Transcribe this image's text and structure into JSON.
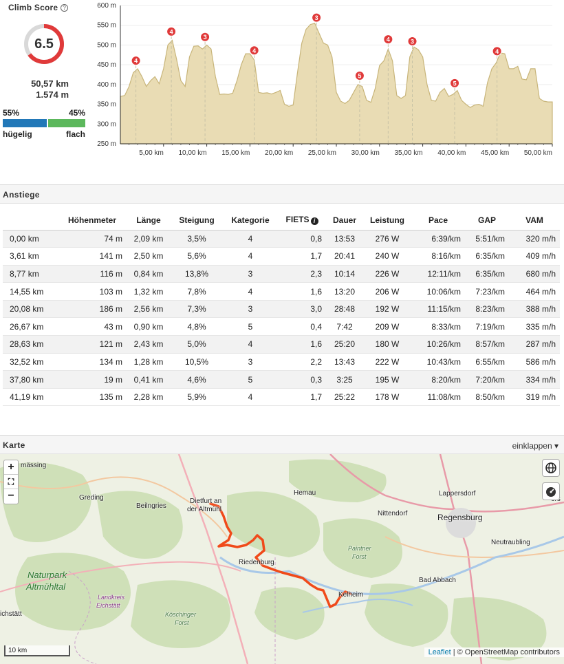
{
  "climb_score": {
    "title": "Climb Score",
    "help_icon": "?",
    "score": "6.5",
    "score_fraction": 0.65,
    "distance": "50,57 km",
    "elevation": "1.574 m",
    "hilly_pct": "55%",
    "flat_pct": "45%",
    "hilly_fraction": 0.55,
    "hilly_label": "hügelig",
    "flat_label": "flach",
    "colors": {
      "ring": "#e03a3a",
      "ring_bg": "#d9d9d9",
      "hilly": "#2278b8",
      "flat": "#5cb85c"
    }
  },
  "chart_data": {
    "type": "area",
    "title": "",
    "xlabel": "",
    "ylabel": "",
    "xlim": [
      0,
      50
    ],
    "ylim": [
      250,
      600
    ],
    "x_ticks": [
      "5,00 km",
      "10,00 km",
      "15,00 km",
      "20,00 km",
      "25,00 km",
      "30,00 km",
      "35,00 km",
      "40,00 km",
      "45,00 km",
      "50,00 km"
    ],
    "y_ticks": [
      "600 m",
      "550 m",
      "500 m",
      "450 m",
      "400 m",
      "350 m",
      "300 m",
      "250 m"
    ],
    "series": [
      {
        "values_km": [
          0,
          0.5,
          1,
          1.5,
          2,
          2.5,
          3,
          3.5,
          4,
          4.5,
          5,
          5.5,
          6,
          6.5,
          7,
          7.5,
          8,
          8.5,
          9,
          9.5,
          10,
          10.5,
          11,
          11.5,
          12,
          12.5,
          13,
          13.5,
          14,
          14.5,
          15,
          15.5,
          16,
          16.5,
          17,
          17.5,
          18,
          18.5,
          19,
          19.5,
          20,
          20.5,
          21,
          21.5,
          22,
          22.5,
          23,
          23.5,
          24,
          24.5,
          25,
          25.5,
          26,
          26.5,
          27,
          27.5,
          28,
          28.5,
          29,
          29.5,
          30,
          30.5,
          31,
          31.5,
          32,
          32.5,
          33,
          33.5,
          34,
          34.5,
          35,
          35.5,
          36,
          36.5,
          37,
          37.5,
          38,
          38.5,
          39,
          39.5,
          40,
          40.5,
          41,
          41.5,
          42,
          42.5,
          43,
          43.5,
          44,
          44.5,
          45,
          45.5,
          46,
          46.5,
          47,
          47.5,
          48,
          48.5,
          49,
          49.5,
          50
        ],
        "values_m": [
          370,
          372,
          395,
          430,
          440,
          420,
          395,
          410,
          420,
          402,
          440,
          500,
          512,
          465,
          410,
          395,
          470,
          497,
          498,
          490,
          500,
          490,
          420,
          375,
          376,
          375,
          378,
          410,
          450,
          478,
          478,
          462,
          380,
          378,
          379,
          376,
          380,
          385,
          350,
          345,
          348,
          430,
          505,
          540,
          552,
          555,
          530,
          505,
          500,
          470,
          380,
          358,
          352,
          360,
          380,
          400,
          395,
          360,
          355,
          390,
          448,
          460,
          490,
          460,
          372,
          365,
          372,
          470,
          495,
          488,
          470,
          400,
          360,
          358,
          380,
          390,
          370,
          375,
          385,
          360,
          350,
          342,
          348,
          350,
          345,
          405,
          440,
          455,
          480,
          478,
          440,
          440,
          446,
          414,
          412,
          440,
          440,
          365,
          358,
          356,
          356,
          360,
          358,
          362,
          360
        ]
      }
    ],
    "markers": [
      {
        "km": 1.8,
        "label": "4"
      },
      {
        "km": 5.9,
        "label": "4"
      },
      {
        "km": 9.8,
        "label": "3"
      },
      {
        "km": 15.5,
        "label": "4"
      },
      {
        "km": 22.7,
        "label": "3"
      },
      {
        "km": 27.7,
        "label": "5"
      },
      {
        "km": 31.0,
        "label": "4"
      },
      {
        "km": 33.8,
        "label": "3"
      },
      {
        "km": 38.7,
        "label": "5"
      },
      {
        "km": 43.6,
        "label": "4"
      }
    ],
    "colors": {
      "fill": "#e9dcb4",
      "line": "#c8b57a",
      "marker": "#e03a3a",
      "dashed": "#c7c2a6"
    }
  },
  "climbs": {
    "section_title": "Anstiege",
    "headers": [
      "",
      "Höhenmeter",
      "Länge",
      "Steigung",
      "Kategorie",
      "FIETS",
      "Dauer",
      "Leistung",
      "Pace",
      "GAP",
      "VAM"
    ],
    "info_icon": "i",
    "rows": [
      [
        "0,00 km",
        "74 m",
        "2,09 km",
        "3,5%",
        "4",
        "0,8",
        "13:53",
        "276 W",
        "6:39/km",
        "5:51/km",
        "320 m/h"
      ],
      [
        "3,61 km",
        "141 m",
        "2,50 km",
        "5,6%",
        "4",
        "1,7",
        "20:41",
        "240 W",
        "8:16/km",
        "6:35/km",
        "409 m/h"
      ],
      [
        "8,77 km",
        "116 m",
        "0,84 km",
        "13,8%",
        "3",
        "2,3",
        "10:14",
        "226 W",
        "12:11/km",
        "6:35/km",
        "680 m/h"
      ],
      [
        "14,55 km",
        "103 m",
        "1,32 km",
        "7,8%",
        "4",
        "1,6",
        "13:20",
        "206 W",
        "10:06/km",
        "7:23/km",
        "464 m/h"
      ],
      [
        "20,08 km",
        "186 m",
        "2,56 km",
        "7,3%",
        "3",
        "3,0",
        "28:48",
        "192 W",
        "11:15/km",
        "8:23/km",
        "388 m/h"
      ],
      [
        "26,67 km",
        "43 m",
        "0,90 km",
        "4,8%",
        "5",
        "0,4",
        "7:42",
        "209 W",
        "8:33/km",
        "7:19/km",
        "335 m/h"
      ],
      [
        "28,63 km",
        "121 m",
        "2,43 km",
        "5,0%",
        "4",
        "1,6",
        "25:20",
        "180 W",
        "10:26/km",
        "8:57/km",
        "287 m/h"
      ],
      [
        "32,52 km",
        "134 m",
        "1,28 km",
        "10,5%",
        "3",
        "2,2",
        "13:43",
        "222 W",
        "10:43/km",
        "6:55/km",
        "586 m/h"
      ],
      [
        "37,80 km",
        "19 m",
        "0,41 km",
        "4,6%",
        "5",
        "0,3",
        "3:25",
        "195 W",
        "8:20/km",
        "7:20/km",
        "334 m/h"
      ],
      [
        "41,19 km",
        "135 m",
        "2,28 km",
        "5,9%",
        "4",
        "1,7",
        "25:22",
        "178 W",
        "11:08/km",
        "8:50/km",
        "319 m/h"
      ]
    ]
  },
  "map": {
    "section_title": "Karte",
    "collapse_label": "einklappen ▾",
    "zoom_in": "+",
    "fullscreen": "⛶",
    "zoom_out": "−",
    "globe_icon": "globe-icon",
    "speedometer_icon": "speedometer-icon",
    "scale": "10 km",
    "attribution_link": "Leaflet",
    "attribution_text": " | © OpenStreetMap contributors",
    "labels": {
      "massing": "mässing",
      "greding": "Greding",
      "beilngries": "Beilngries",
      "dietfurt_1": "Dietfurt an",
      "dietfurt_2": "der Altmühl",
      "hemau": "Hemau",
      "lappersdorf": "Lappersdorf",
      "nittendorf": "Nittendorf",
      "regensburg": "Regensburg",
      "neutraubling": "Neutraubling",
      "paintner_1": "Paintner",
      "paintner_2": "Forst",
      "riedenburg": "Riedenburg",
      "kelheim": "Kelheim",
      "bad_abbach": "Bad Abbach",
      "naturpark_1": "Naturpark",
      "naturpark_2": "Altmühltal",
      "landkreis_1": "Landkreis",
      "landkreis_2": "Eichstätt",
      "koschinger_1": "Köschinger",
      "koschinger_2": "Forst",
      "eichstatt": "ichstätt",
      "edge_right": "ors"
    },
    "colors": {
      "route": "#f04a1a",
      "forest": "#cfe0b8",
      "road": "#f4b0b8"
    }
  }
}
